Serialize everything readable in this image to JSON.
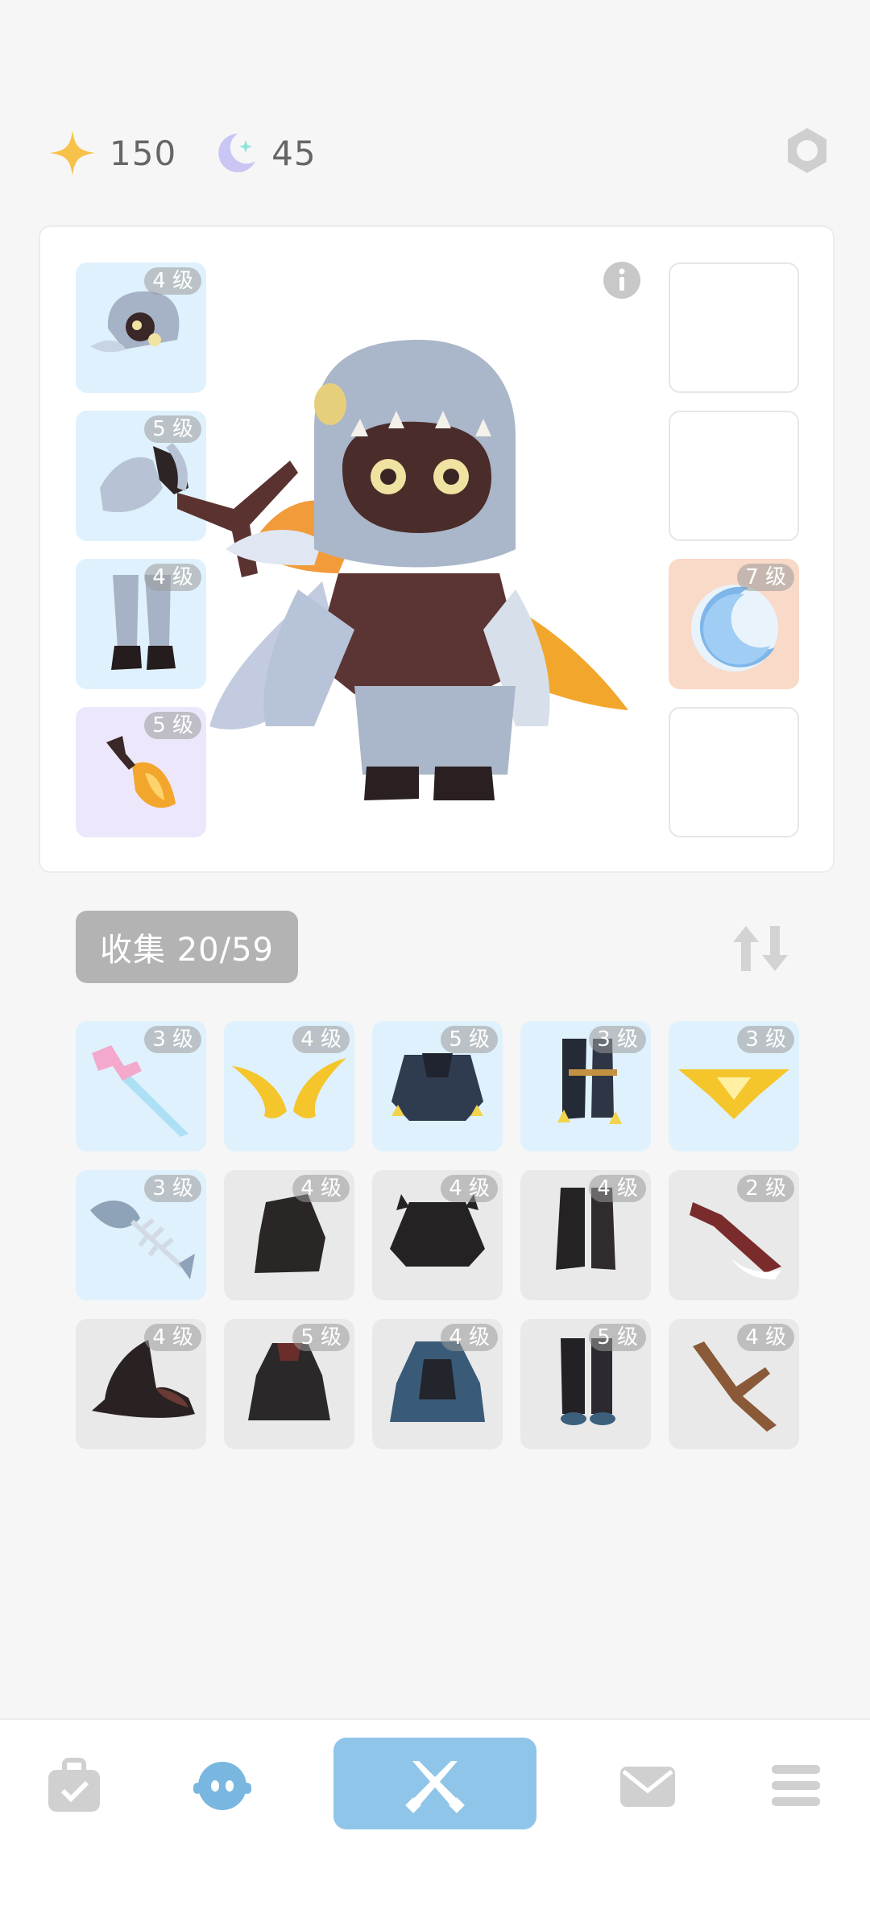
{
  "currency": {
    "stars": {
      "icon": "star-icon",
      "value": "150"
    },
    "moons": {
      "icon": "moon-icon",
      "value": "45"
    }
  },
  "equipped_left": [
    {
      "level": "4 级",
      "icon": "helmet-icon",
      "rarity": "blue"
    },
    {
      "level": "5 级",
      "icon": "gauntlet-icon",
      "rarity": "blue"
    },
    {
      "level": "4 级",
      "icon": "boots-icon",
      "rarity": "blue"
    },
    {
      "level": "5 级",
      "icon": "flame-sword-icon",
      "rarity": "purple"
    }
  ],
  "equipped_right": [
    {
      "level": "",
      "icon": "",
      "rarity": "empty"
    },
    {
      "level": "",
      "icon": "",
      "rarity": "empty"
    },
    {
      "level": "7 级",
      "icon": "crescent-moon-icon",
      "rarity": "orange"
    },
    {
      "level": "",
      "icon": "",
      "rarity": "empty"
    }
  ],
  "collection": {
    "label": "收集 20/59",
    "items": [
      {
        "level": "3 级",
        "icon": "pink-sword-icon",
        "rarity": "blue"
      },
      {
        "level": "4 级",
        "icon": "golden-wings-icon",
        "rarity": "blue"
      },
      {
        "level": "5 级",
        "icon": "dark-armor-icon",
        "rarity": "blue"
      },
      {
        "level": "3 级",
        "icon": "claw-boots-icon",
        "rarity": "blue"
      },
      {
        "level": "3 级",
        "icon": "golden-crest-icon",
        "rarity": "blue"
      },
      {
        "level": "3 级",
        "icon": "fish-bone-icon",
        "rarity": "blue"
      },
      {
        "level": "4 级",
        "icon": "black-rock-icon",
        "rarity": "grey"
      },
      {
        "level": "4 级",
        "icon": "spiky-armor-icon",
        "rarity": "grey"
      },
      {
        "level": "4 级",
        "icon": "black-boots-icon",
        "rarity": "grey"
      },
      {
        "level": "2 级",
        "icon": "red-blade-icon",
        "rarity": "grey"
      },
      {
        "level": "4 级",
        "icon": "witch-hat-icon",
        "rarity": "grey"
      },
      {
        "level": "5 级",
        "icon": "dark-cloak-icon",
        "rarity": "grey"
      },
      {
        "level": "4 级",
        "icon": "blue-cloak-icon",
        "rarity": "grey"
      },
      {
        "level": "5 级",
        "icon": "blue-boots-icon",
        "rarity": "grey"
      },
      {
        "level": "4 级",
        "icon": "branch-icon",
        "rarity": "grey"
      }
    ]
  },
  "nav": [
    {
      "icon": "bag-icon",
      "active": false
    },
    {
      "icon": "character-icon",
      "active": true
    },
    {
      "icon": "battle-swords-icon",
      "active": false
    },
    {
      "icon": "mail-icon",
      "active": false
    },
    {
      "icon": "menu-icon",
      "active": false
    }
  ],
  "colors": {
    "accent": "#8ec5e8",
    "blue_slot": "#dff1fc",
    "purple_slot": "#ece7fb",
    "orange_slot": "#f9d9c8",
    "grey_slot": "#e9e9e9"
  }
}
